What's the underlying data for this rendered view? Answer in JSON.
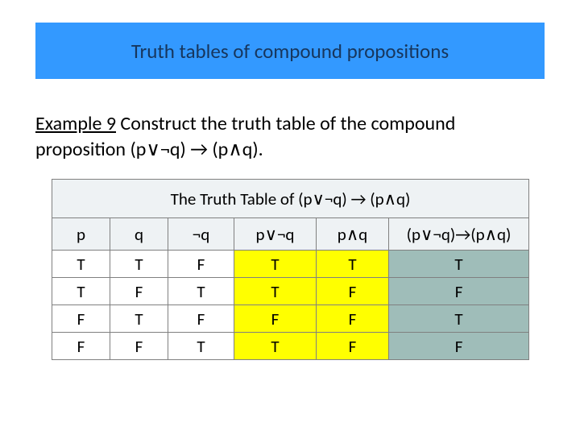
{
  "header": {
    "title": "Truth tables of compound propositions"
  },
  "example": {
    "label": "Example 9",
    "text": " Construct the truth table of the compound proposition (p∨¬q) → (p∧q)."
  },
  "table": {
    "caption": "The Truth Table of (p∨¬q) → (p∧q)",
    "columns": [
      "p",
      "q",
      "¬q",
      "p∨¬q",
      "p∧q",
      "(p∨¬q)→(p∧q)"
    ],
    "highlight": [
      "",
      "",
      "",
      "yellow",
      "yellow",
      "teal"
    ],
    "rows": [
      [
        "T",
        "T",
        "F",
        "T",
        "T",
        "T"
      ],
      [
        "T",
        "F",
        "T",
        "T",
        "F",
        "F"
      ],
      [
        "F",
        "T",
        "F",
        "F",
        "F",
        "T"
      ],
      [
        "F",
        "F",
        "T",
        "T",
        "F",
        "F"
      ]
    ]
  },
  "chart_data": {
    "type": "table",
    "title": "The Truth Table of (p∨¬q) → (p∧q)",
    "columns": [
      "p",
      "q",
      "¬q",
      "p∨¬q",
      "p∧q",
      "(p∨¬q)→(p∧q)"
    ],
    "rows": [
      {
        "p": "T",
        "q": "T",
        "¬q": "F",
        "p∨¬q": "T",
        "p∧q": "T",
        "(p∨¬q)→(p∧q)": "T"
      },
      {
        "p": "T",
        "q": "F",
        "¬q": "T",
        "p∨¬q": "T",
        "p∧q": "F",
        "(p∨¬q)→(p∧q)": "F"
      },
      {
        "p": "F",
        "q": "T",
        "¬q": "F",
        "p∨¬q": "F",
        "p∧q": "F",
        "(p∨¬q)→(p∧q)": "T"
      },
      {
        "p": "F",
        "q": "F",
        "¬q": "T",
        "p∨¬q": "T",
        "p∧q": "F",
        "(p∨¬q)→(p∧q)": "F"
      }
    ]
  }
}
